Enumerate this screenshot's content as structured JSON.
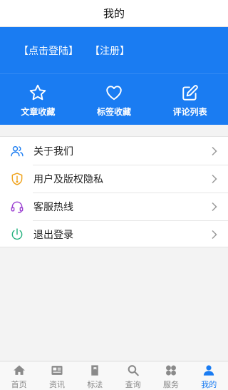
{
  "header": {
    "title": "我的"
  },
  "account": {
    "login": "【点击登陆】",
    "register": "【注册】"
  },
  "quick_actions": [
    {
      "label": "文章收藏",
      "icon": "star-icon"
    },
    {
      "label": "标签收藏",
      "icon": "heart-icon"
    },
    {
      "label": "评论列表",
      "icon": "edit-icon"
    }
  ],
  "menu": [
    {
      "label": "关于我们",
      "icon": "users-icon",
      "color": "#1a7cf2"
    },
    {
      "label": "用户及版权隐私",
      "icon": "shield-icon",
      "color": "#f0a21a"
    },
    {
      "label": "客服热线",
      "icon": "headset-icon",
      "color": "#9b3fd1"
    },
    {
      "label": "退出登录",
      "icon": "power-icon",
      "color": "#22b07d"
    }
  ],
  "tabs": [
    {
      "label": "首页",
      "icon": "home-icon",
      "active": false
    },
    {
      "label": "资讯",
      "icon": "news-icon",
      "active": false
    },
    {
      "label": "标法",
      "icon": "book-icon",
      "active": false
    },
    {
      "label": "查询",
      "icon": "search-icon",
      "active": false
    },
    {
      "label": "服务",
      "icon": "grid-icon",
      "active": false
    },
    {
      "label": "我的",
      "icon": "user-icon",
      "active": true
    }
  ],
  "colors": {
    "brand": "#1a7cf2",
    "tab_inactive": "#888888"
  }
}
